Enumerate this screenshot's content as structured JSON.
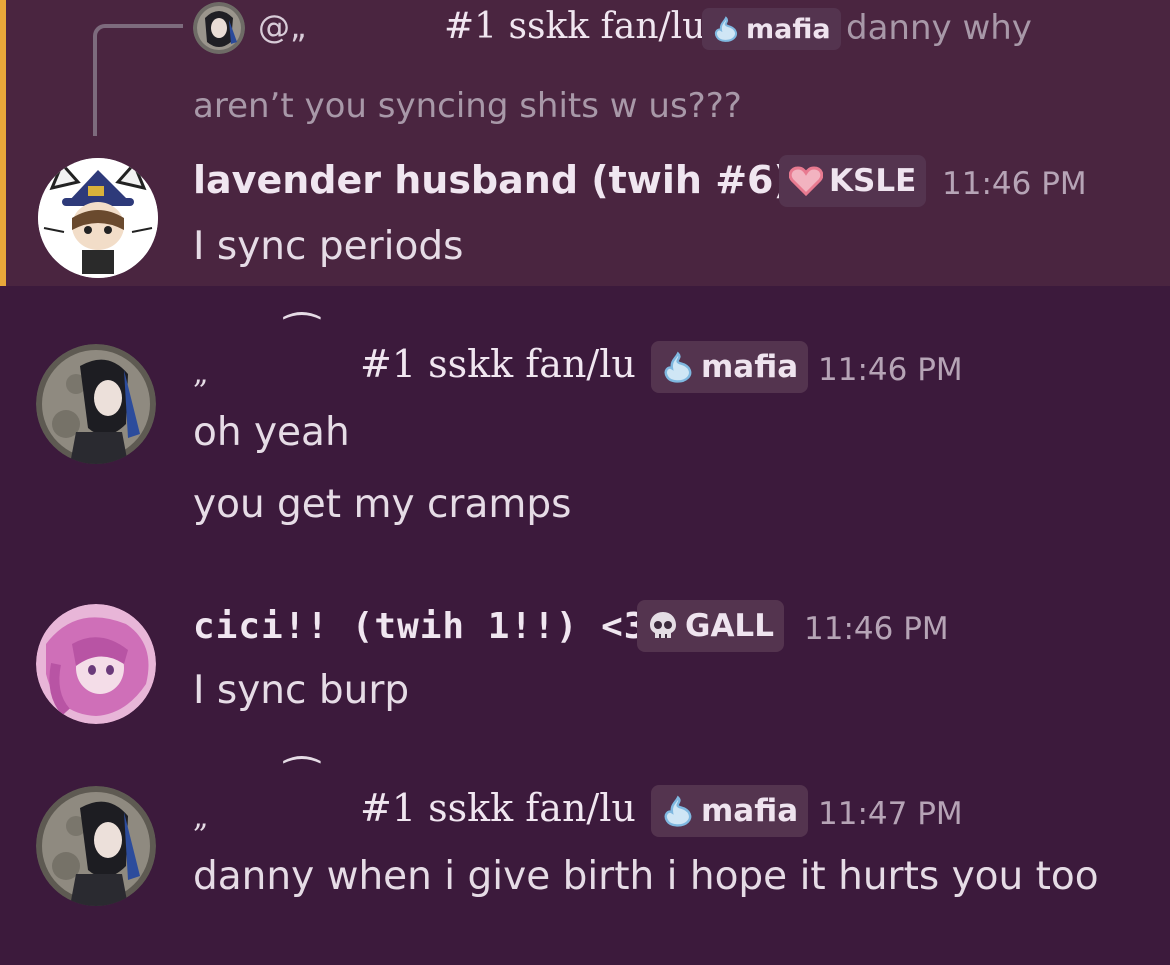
{
  "reply_preview": {
    "at_prefix": "@„",
    "author": "#1 sskk fan/lu",
    "badge": "mafia",
    "text_line1": "danny why",
    "text_line2": "aren’t you syncing shits w us???"
  },
  "messages": [
    {
      "author": "lavender husband (twih #6)",
      "badge": "KSLE",
      "time": "11:46 PM",
      "lines": [
        "I sync periods"
      ]
    },
    {
      "author_prefix": "„",
      "author": "#1 sskk fan/lu",
      "badge": "mafia",
      "time": "11:46 PM",
      "lines": [
        "oh yeah",
        "you get my cramps"
      ]
    },
    {
      "author": "cici!! (twih 1!!) <333",
      "badge": "GALL",
      "time": "11:46 PM",
      "lines": [
        "I sync burp"
      ]
    },
    {
      "author_prefix": "„",
      "author": "#1 sskk fan/lu",
      "badge": "mafia",
      "time": "11:47 PM",
      "lines": [
        "danny when i give birth i hope it hurts you too"
      ]
    }
  ],
  "colors": {
    "background": "#3c1a3c",
    "highlight": "#4a2540",
    "highlight_bar": "#e8a83a"
  }
}
